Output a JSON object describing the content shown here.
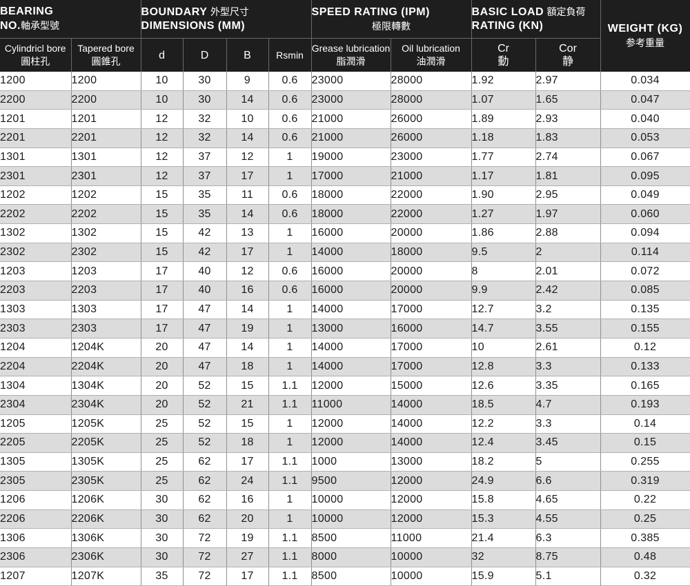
{
  "header": {
    "bearing": {
      "title1": "BEARING",
      "title2": "NO.",
      "zh": "軸承型號"
    },
    "boundary": {
      "title1": "BOUNDARY",
      "zh": "外型尺寸",
      "title2": "DIMENSIONS (MM)"
    },
    "speed": {
      "title": "SPEED RATING (IPM)",
      "zh": "極限轉數"
    },
    "load": {
      "title1": "BASIC LOAD",
      "zh": "額定負荷",
      "title2": "RATING (KN)"
    },
    "weight": {
      "title": "WEIGHT (KG)",
      "zh": "参考重量"
    },
    "sub": {
      "cyl": "Cylindricl bore",
      "cyl_zh": "圓柱孔",
      "tap": "Tapered bore",
      "tap_zh": "圓錐孔",
      "d": "d",
      "D": "D",
      "B": "B",
      "rs": "Rsmin",
      "grease": "Grease lubrication",
      "grease_zh": "脂潤滑",
      "oil": "Oil lubrication",
      "oil_zh": "油潤滑",
      "cr": "Cr",
      "cr_zh": "動",
      "cor": "Cor",
      "cor_zh": "静"
    }
  },
  "rows": [
    [
      "1200",
      "1200",
      "10",
      "30",
      "9",
      "0.6",
      "23000",
      "28000",
      "1.92",
      "2.97",
      "0.034"
    ],
    [
      "2200",
      "2200",
      "10",
      "30",
      "14",
      "0.6",
      "23000",
      "28000",
      "1.07",
      "1.65",
      "0.047"
    ],
    [
      "1201",
      "1201",
      "12",
      "32",
      "10",
      "0.6",
      "21000",
      "26000",
      "1.89",
      "2.93",
      "0.040"
    ],
    [
      "2201",
      "2201",
      "12",
      "32",
      "14",
      "0.6",
      "21000",
      "26000",
      "1.18",
      "1.83",
      "0.053"
    ],
    [
      "1301",
      "1301",
      "12",
      "37",
      "12",
      "1",
      "19000",
      "23000",
      "1.77",
      "2.74",
      "0.067"
    ],
    [
      "2301",
      "2301",
      "12",
      "37",
      "17",
      "1",
      "17000",
      "21000",
      "1.17",
      "1.81",
      "0.095"
    ],
    [
      "1202",
      "1202",
      "15",
      "35",
      "11",
      "0.6",
      "18000",
      "22000",
      "1.90",
      "2.95",
      "0.049"
    ],
    [
      "2202",
      "2202",
      "15",
      "35",
      "14",
      "0.6",
      "18000",
      "22000",
      "1.27",
      "1.97",
      "0.060"
    ],
    [
      "1302",
      "1302",
      "15",
      "42",
      "13",
      "1",
      "16000",
      "20000",
      "1.86",
      "2.88",
      "0.094"
    ],
    [
      "2302",
      "2302",
      "15",
      "42",
      "17",
      "1",
      "14000",
      "18000",
      "9.5",
      "2",
      "0.114"
    ],
    [
      "1203",
      "1203",
      "17",
      "40",
      "12",
      "0.6",
      "16000",
      "20000",
      "8",
      "2.01",
      "0.072"
    ],
    [
      "2203",
      "2203",
      "17",
      "40",
      "16",
      "0.6",
      "16000",
      "20000",
      "9.9",
      "2.42",
      "0.085"
    ],
    [
      "1303",
      "1303",
      "17",
      "47",
      "14",
      "1",
      "14000",
      "17000",
      "12.7",
      "3.2",
      "0.135"
    ],
    [
      "2303",
      "2303",
      "17",
      "47",
      "19",
      "1",
      "13000",
      "16000",
      "14.7",
      "3.55",
      "0.155"
    ],
    [
      "1204",
      "1204K",
      "20",
      "47",
      "14",
      "1",
      "14000",
      "17000",
      "10",
      "2.61",
      "0.12"
    ],
    [
      "2204",
      "2204K",
      "20",
      "47",
      "18",
      "1",
      "14000",
      "17000",
      "12.8",
      "3.3",
      "0.133"
    ],
    [
      "1304",
      "1304K",
      "20",
      "52",
      "15",
      "1.1",
      "12000",
      "15000",
      "12.6",
      "3.35",
      "0.165"
    ],
    [
      "2304",
      "2304K",
      "20",
      "52",
      "21",
      "1.1",
      "11000",
      "14000",
      "18.5",
      "4.7",
      "0.193"
    ],
    [
      "1205",
      "1205K",
      "25",
      "52",
      "15",
      "1",
      "12000",
      "14000",
      "12.2",
      "3.3",
      "0.14"
    ],
    [
      "2205",
      "2205K",
      "25",
      "52",
      "18",
      "1",
      "12000",
      "14000",
      "12.4",
      "3.45",
      "0.15"
    ],
    [
      "1305",
      "1305K",
      "25",
      "62",
      "17",
      "1.1",
      "1000",
      "13000",
      "18.2",
      "5",
      "0.255"
    ],
    [
      "2305",
      "2305K",
      "25",
      "62",
      "24",
      "1.1",
      "9500",
      "12000",
      "24.9",
      "6.6",
      "0.319"
    ],
    [
      "1206",
      "1206K",
      "30",
      "62",
      "16",
      "1",
      "10000",
      "12000",
      "15.8",
      "4.65",
      "0.22"
    ],
    [
      "2206",
      "2206K",
      "30",
      "62",
      "20",
      "1",
      "10000",
      "12000",
      "15.3",
      "4.55",
      "0.25"
    ],
    [
      "1306",
      "1306K",
      "30",
      "72",
      "19",
      "1.1",
      "8500",
      "11000",
      "21.4",
      "6.3",
      "0.385"
    ],
    [
      "2306",
      "2306K",
      "30",
      "72",
      "27",
      "1.1",
      "8000",
      "10000",
      "32",
      "8.75",
      "0.48"
    ],
    [
      "1207",
      "1207K",
      "35",
      "72",
      "17",
      "1.1",
      "8500",
      "10000",
      "15.9",
      "5.1",
      "0.32"
    ]
  ]
}
